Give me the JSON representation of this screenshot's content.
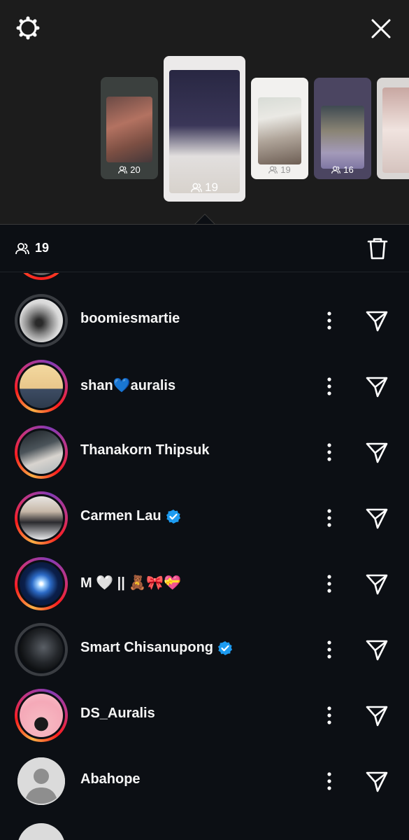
{
  "header": {
    "settings_icon": "gear-icon",
    "close_icon": "close-icon"
  },
  "story_thumbnails": [
    {
      "viewers": "20",
      "selected": false
    },
    {
      "viewers": "19",
      "selected": true
    },
    {
      "viewers": "19",
      "selected": false
    },
    {
      "viewers": "16",
      "selected": false
    },
    {
      "viewers": "",
      "selected": false
    }
  ],
  "viewers_bar": {
    "count": "19",
    "viewers_icon": "people-icon",
    "delete_icon": "trash-icon"
  },
  "viewers": [
    {
      "name": "boomiesmartie",
      "verified": false,
      "ring": "seen"
    },
    {
      "name": "shan💙auralis",
      "verified": false,
      "ring": "story"
    },
    {
      "name": "Thanakorn Thipsuk",
      "verified": false,
      "ring": "story"
    },
    {
      "name": "Carmen Lau",
      "verified": true,
      "ring": "story"
    },
    {
      "name": "M 🤍 || 🧸🎀💝",
      "verified": false,
      "ring": "story"
    },
    {
      "name": "Smart Chisanupong",
      "verified": true,
      "ring": "seen"
    },
    {
      "name": "DS_Auralis",
      "verified": false,
      "ring": "story"
    },
    {
      "name": "Abahope",
      "verified": false,
      "ring": "none"
    }
  ],
  "colors": {
    "background": "#0c0f14",
    "top_background": "#1c1c1c",
    "verified_blue": "#1d9bf0"
  }
}
